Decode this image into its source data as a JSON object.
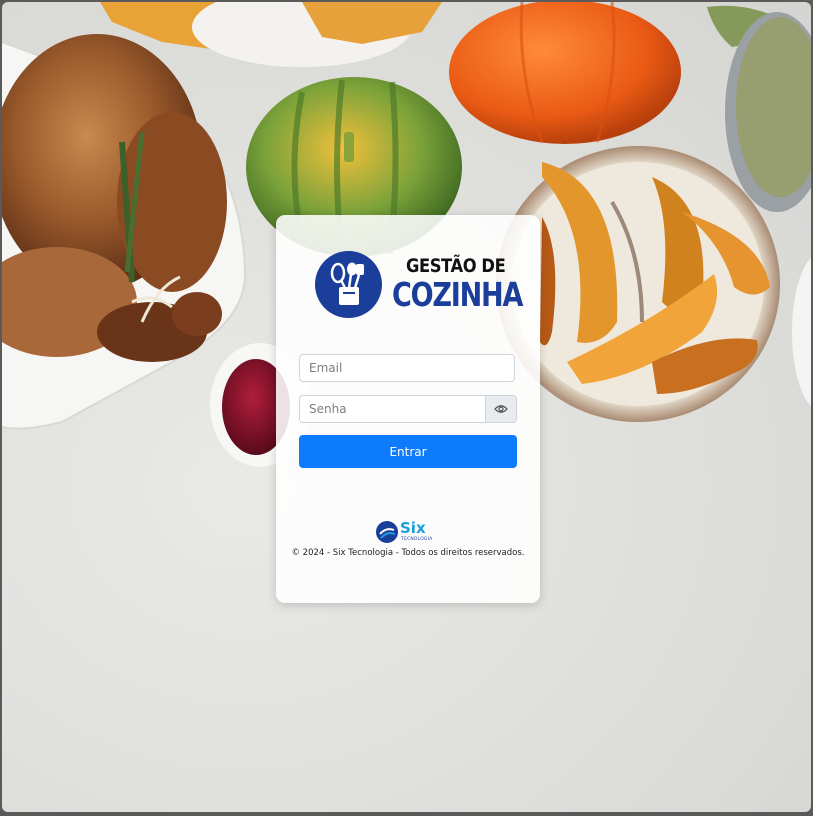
{
  "brand": {
    "line1": "GESTÃO DE",
    "line2": "COZINHA",
    "logo_icon": "kitchen-utensils-icon"
  },
  "login": {
    "email_placeholder": "Email",
    "password_placeholder": "Senha",
    "toggle_icon": "eye-icon",
    "submit_label": "Entrar"
  },
  "footer": {
    "company_logo_word": "Six",
    "company_logo_sub": "TECNOLOGIA",
    "copyright": "© 2024 - Six Tecnologia - Todos os direitos reservados."
  },
  "colors": {
    "primary": "#0d7bfb",
    "brand_navy": "#1a3e9a",
    "six_cyan": "#1aa0d8"
  }
}
